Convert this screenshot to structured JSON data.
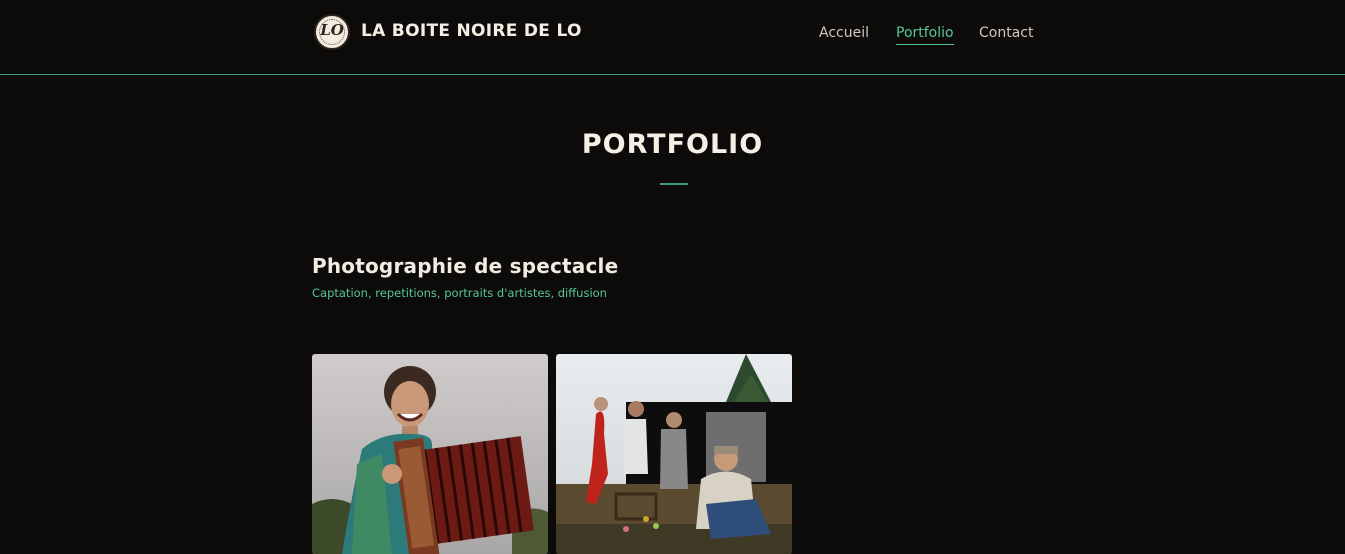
{
  "header": {
    "logo_text": "LO",
    "site_title": "LA BOITE NOIRE DE LO",
    "nav": [
      {
        "label": "Accueil",
        "active": false
      },
      {
        "label": "Portfolio",
        "active": true
      },
      {
        "label": "Contact",
        "active": false
      }
    ]
  },
  "main": {
    "page_title": "PORTFOLIO",
    "section": {
      "title": "Photographie de spectacle",
      "subtitle": "Captation, repetitions, portraits d'artistes, diffusion"
    },
    "gallery": [
      {
        "icon": "accordion-player-photo"
      },
      {
        "icon": "street-performers-photo"
      }
    ]
  },
  "colors": {
    "background": "#0c0b0a",
    "accent": "#56c79a",
    "text": "#f4eee4"
  }
}
